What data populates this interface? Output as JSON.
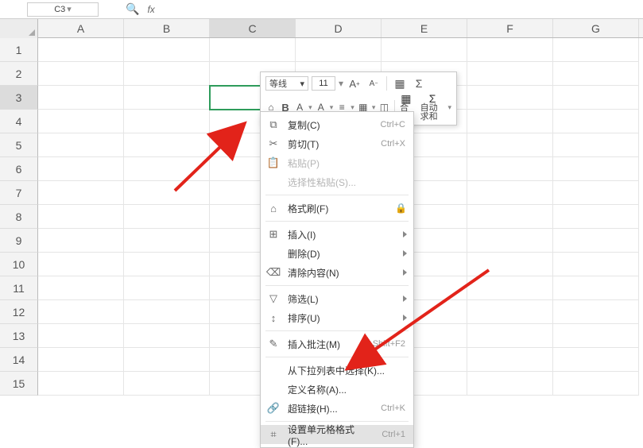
{
  "namebox": {
    "value": "C3"
  },
  "fx_label": "fx",
  "columns": [
    "A",
    "B",
    "C",
    "D",
    "E",
    "F",
    "G"
  ],
  "active_col": "C",
  "row_numbers": [
    1,
    2,
    3,
    4,
    5,
    6,
    7,
    8,
    9,
    10,
    11,
    12,
    13,
    14,
    15
  ],
  "active_row": 3,
  "mini_toolbar": {
    "font_name": "等线",
    "font_size": "11",
    "grow": "A",
    "shrink": "A",
    "bold": "B",
    "hl": "A",
    "fc": "A",
    "merge_label": "合并",
    "autosum_label": "自动求和"
  },
  "ctx": {
    "copy": {
      "label": "复制(C)",
      "shortcut": "Ctrl+C",
      "icon": "⧉"
    },
    "cut": {
      "label": "剪切(T)",
      "shortcut": "Ctrl+X",
      "icon": "✂"
    },
    "paste": {
      "label": "粘贴(P)",
      "icon": "📋"
    },
    "pspecial": {
      "label": "选择性粘贴(S)...",
      "icon": ""
    },
    "fmtpaint": {
      "label": "格式刷(F)",
      "icon": "⌂"
    },
    "insert": {
      "label": "插入(I)",
      "icon": "⊞"
    },
    "delete": {
      "label": "删除(D)",
      "icon": ""
    },
    "clear": {
      "label": "清除内容(N)",
      "icon": "⌫"
    },
    "filter": {
      "label": "筛选(L)",
      "icon": "▽"
    },
    "sort": {
      "label": "排序(U)",
      "icon": "↕"
    },
    "comment": {
      "label": "插入批注(M)",
      "shortcut": "Shift+F2",
      "icon": "✎"
    },
    "dropdown": {
      "label": "从下拉列表中选择(K)..."
    },
    "defname": {
      "label": "定义名称(A)..."
    },
    "hyperlink": {
      "label": "超链接(H)...",
      "shortcut": "Ctrl+K",
      "icon": "🔗"
    },
    "formatcell": {
      "label": "设置单元格格式(F)...",
      "shortcut": "Ctrl+1",
      "icon": "⌗"
    }
  }
}
